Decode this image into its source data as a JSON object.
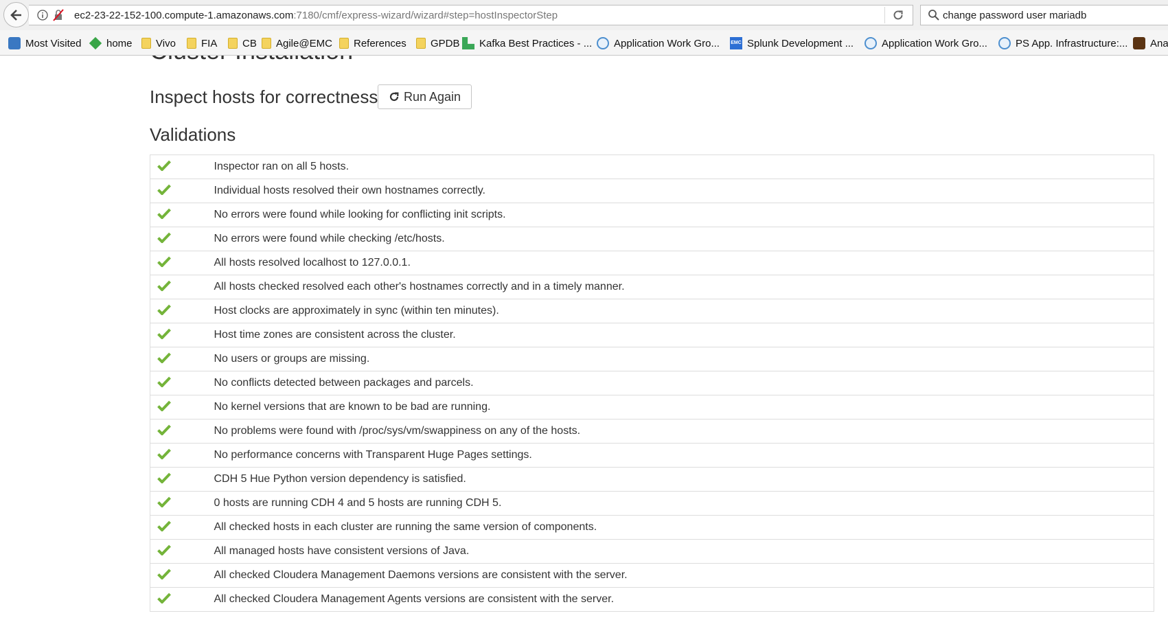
{
  "browser": {
    "url_host": "ec2-23-22-152-100.compute-1.amazonaws.com",
    "url_rest": ":7180/cmf/express-wizard/wizard#step=hostInspectorStep",
    "search_value": "change password user mariadb",
    "bookmarks": [
      {
        "label": "Most Visited",
        "icon": "most-visited-icon"
      },
      {
        "label": "home",
        "icon": "home-icon"
      },
      {
        "label": "Vivo",
        "icon": "folder-icon"
      },
      {
        "label": "FIA",
        "icon": "folder-icon"
      },
      {
        "label": "CB",
        "icon": "folder-icon"
      },
      {
        "label": "Agile@EMC",
        "icon": "folder-icon"
      },
      {
        "label": "References",
        "icon": "folder-icon"
      },
      {
        "label": "GPDB",
        "icon": "folder-icon"
      },
      {
        "label": "Kafka Best Practices - ...",
        "icon": "kafka-icon"
      },
      {
        "label": "Application Work Gro...",
        "icon": "globe-icon"
      },
      {
        "label": "Splunk Development ...",
        "icon": "emc-icon"
      },
      {
        "label": "Application Work Gro...",
        "icon": "globe-icon"
      },
      {
        "label": "PS App. Infrastructure:...",
        "icon": "globe-icon"
      },
      {
        "label": "Ana",
        "icon": "ana-icon"
      }
    ]
  },
  "page": {
    "title": "Cluster Installation",
    "inspect_heading": "Inspect hosts for correctness",
    "run_again_label": "Run Again",
    "validations_heading": "Validations",
    "check_color": "#74b43a",
    "validations": [
      "Inspector ran on all 5 hosts.",
      "Individual hosts resolved their own hostnames correctly.",
      "No errors were found while looking for conflicting init scripts.",
      "No errors were found while checking /etc/hosts.",
      "All hosts resolved localhost to 127.0.0.1.",
      "All hosts checked resolved each other's hostnames correctly and in a timely manner.",
      "Host clocks are approximately in sync (within ten minutes).",
      "Host time zones are consistent across the cluster.",
      "No users or groups are missing.",
      "No conflicts detected between packages and parcels.",
      "No kernel versions that are known to be bad are running.",
      "No problems were found with /proc/sys/vm/swappiness on any of the hosts.",
      "No performance concerns with Transparent Huge Pages settings.",
      "CDH 5 Hue Python version dependency is satisfied.",
      "0 hosts are running CDH 4 and 5 hosts are running CDH 5.",
      "All checked hosts in each cluster are running the same version of components.",
      "All managed hosts have consistent versions of Java.",
      "All checked Cloudera Management Daemons versions are consistent with the server.",
      "All checked Cloudera Management Agents versions are consistent with the server."
    ]
  }
}
